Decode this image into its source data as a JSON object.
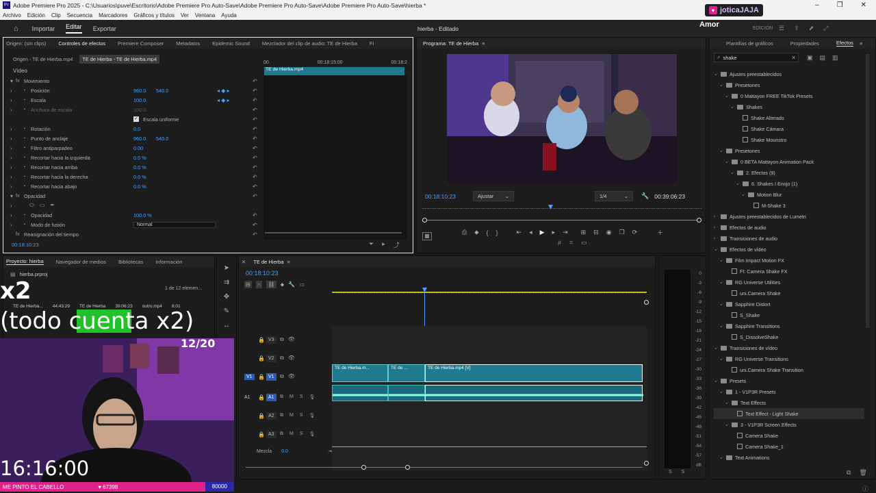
{
  "titlebar": {
    "title": "Adobe Premiere Pro 2025 - C:\\Usuarios\\puve\\Escritorio\\Adobe Premiere Pro Auto-Save\\Adobe Premiere Pro Auto-Save\\Adobe Premiere Pro Auto-Save\\hierba *",
    "app_icon": "Pr"
  },
  "menu": [
    "Archivo",
    "Edición",
    "Clip",
    "Secuencia",
    "Marcadores",
    "Gráficos y títulos",
    "Ver",
    "Ventana",
    "Ayuda"
  ],
  "workspace": {
    "tabs": [
      "Importar",
      "Editar",
      "Exportar"
    ],
    "active": "Editar",
    "project_title": "hierba - Editado",
    "edition_label": "EDICIÓN"
  },
  "stream_overlay": {
    "follower_badge": "joticaJAJA",
    "follower_label": "Amor",
    "counter_big": "x2",
    "counter_text": "(todo cuenta x2)",
    "progress": "12/20",
    "clock": "16:16:00",
    "footer_left": "ME PINTO EL CABELLO",
    "footer_count": "67398",
    "footer_right": "80000"
  },
  "effect_controls": {
    "tabs": [
      "Origen: (sin clips)",
      "Controles de efectos",
      "Premiere Composer",
      "Metadatos",
      "Epidemic Sound",
      "Mezclador del clip de audio: TE de Hierba",
      "Fi"
    ],
    "source_tabs": [
      "Origen - TE de Hierba.mp4",
      "TE de Hierba - TE de Hierba.mp4"
    ],
    "ruler": [
      "00",
      "00:18:15:00",
      "00:18:2"
    ],
    "clip_label": "TE de Hierba.mp4",
    "section_video": "Vídeo",
    "rows": [
      {
        "label": "Movimiento",
        "v1": "",
        "v2": ""
      },
      {
        "label": "Posición",
        "v1": "960.0",
        "v2": "540.0"
      },
      {
        "label": "Escala",
        "v1": "100.0",
        "v2": ""
      },
      {
        "label": "Anchura de escala",
        "v1": "100.0",
        "v2": ""
      },
      {
        "label": "Escala uniforme",
        "v1": "",
        "v2": ""
      },
      {
        "label": "Rotación",
        "v1": "0.0",
        "v2": ""
      },
      {
        "label": "Punto de anclaje",
        "v1": "960.0",
        "v2": "540.0"
      },
      {
        "label": "Filtro antiparpadeo",
        "v1": "0.00",
        "v2": ""
      },
      {
        "label": "Recortar hacia la izquierda",
        "v1": "0.0 %",
        "v2": ""
      },
      {
        "label": "Recortar hacia arriba",
        "v1": "0.0 %",
        "v2": ""
      },
      {
        "label": "Recortar hacia la derecha",
        "v1": "0.0 %",
        "v2": ""
      },
      {
        "label": "Recortar hacia abajo",
        "v1": "0.0 %",
        "v2": ""
      },
      {
        "label": "Opacidad",
        "v1": "",
        "v2": ""
      },
      {
        "label": "",
        "v1": "",
        "v2": ""
      },
      {
        "label": "Opacidad",
        "v1": "100.0 %",
        "v2": ""
      },
      {
        "label": "Modo de fusión",
        "v1": "Normal",
        "v2": ""
      },
      {
        "label": "Reasignación del tiempo",
        "v1": "",
        "v2": ""
      }
    ],
    "timecode": "00:18:10:23"
  },
  "program": {
    "title": "Programa: TE de Hierba",
    "timecode": "00:18:10:23",
    "fit": "Ajustar",
    "resolution": "1/4",
    "duration": "00:39:06:23"
  },
  "project": {
    "tabs": [
      "Proyecto: hierba",
      "Navegador de medios",
      "Bibliotecas",
      "Información"
    ],
    "file": "hierba.prproj",
    "count": "1 de 12 elemen...",
    "items": [
      {
        "name": "TE de Hierba...",
        "dur": "44:43:29"
      },
      {
        "name": "TE de Hierba",
        "dur": "39:06:23"
      },
      {
        "name": "outro.mp4",
        "dur": "8:01"
      }
    ]
  },
  "timeline": {
    "tab": "TE de Hierba",
    "timecode": "00:18:10:23",
    "tracks": [
      {
        "name": "V3"
      },
      {
        "name": "V2"
      },
      {
        "name": "V1"
      },
      {
        "name": "A1"
      },
      {
        "name": "A2"
      },
      {
        "name": "A3"
      }
    ],
    "source_patch": [
      "V1",
      "A1"
    ],
    "mix_label": "Mezcla",
    "mix_value": "0.0",
    "clips": [
      "TE de Hierba.m...",
      "TE de ...",
      "TE de Hierba.mp4 [V]"
    ]
  },
  "meter": {
    "labels": [
      "0",
      "-3",
      "-6",
      "-9",
      "-12",
      "-15",
      "-18",
      "-21",
      "-24",
      "-27",
      "-30",
      "-33",
      "-36",
      "-39",
      "-42",
      "-45",
      "-48",
      "-51",
      "-54",
      "-57",
      "dB"
    ],
    "solo": [
      "S",
      "S"
    ]
  },
  "effects": {
    "tabs": [
      "Plantillas de gráficos",
      "Propiedades",
      "Efectos"
    ],
    "search": "shake",
    "tree": [
      {
        "d": 0,
        "t": "folder",
        "label": "Ajustes preestablecidos"
      },
      {
        "d": 1,
        "t": "folder",
        "label": "Presetones"
      },
      {
        "d": 2,
        "t": "folder",
        "label": "0 Mattayon FREE TikTok Presets"
      },
      {
        "d": 3,
        "t": "folder",
        "label": "Shakes"
      },
      {
        "d": 4,
        "t": "fx",
        "label": "Shake Alterado"
      },
      {
        "d": 4,
        "t": "fx",
        "label": "Shake Cámara"
      },
      {
        "d": 4,
        "t": "fx",
        "label": "Shake Mounstro"
      },
      {
        "d": 1,
        "t": "folder",
        "label": "Presetones"
      },
      {
        "d": 2,
        "t": "folder",
        "label": "0 BETA Mattayon Animation Pack"
      },
      {
        "d": 3,
        "t": "folder",
        "label": "2. Efectos (9)"
      },
      {
        "d": 4,
        "t": "folder",
        "label": "6. Shakes I Enojo (1)"
      },
      {
        "d": 5,
        "t": "folder",
        "label": "Motion Blur"
      },
      {
        "d": 6,
        "t": "fx",
        "label": "M-Shake 3"
      },
      {
        "d": 0,
        "t": "folder",
        "label": "Ajustes preestablecidos de Lumetri"
      },
      {
        "d": 0,
        "t": "folder",
        "label": "Efectos de audio"
      },
      {
        "d": 0,
        "t": "folder",
        "label": "Transiciones de audio"
      },
      {
        "d": 0,
        "t": "folder",
        "label": "Efectos de vídeo"
      },
      {
        "d": 1,
        "t": "folder",
        "label": "Film Impact Motion FX"
      },
      {
        "d": 2,
        "t": "fx",
        "label": "FI: Camera Shake FX"
      },
      {
        "d": 1,
        "t": "folder",
        "label": "RG Universe Utilities"
      },
      {
        "d": 2,
        "t": "fx",
        "label": "uni.Camera Shake"
      },
      {
        "d": 1,
        "t": "folder",
        "label": "Sapphire Distort"
      },
      {
        "d": 2,
        "t": "fx",
        "label": "S_Shake"
      },
      {
        "d": 1,
        "t": "folder",
        "label": "Sapphire Transitions"
      },
      {
        "d": 2,
        "t": "fx",
        "label": "S_DissolveShake"
      },
      {
        "d": 0,
        "t": "folder",
        "label": "Transiciones de vídeo"
      },
      {
        "d": 1,
        "t": "folder",
        "label": "RG Universe Transitions"
      },
      {
        "d": 2,
        "t": "fx",
        "label": "uni.Camera Shake Transition"
      },
      {
        "d": 0,
        "t": "folder",
        "label": "Presets"
      },
      {
        "d": 1,
        "t": "folder",
        "label": "1 - V1P3R Presets"
      },
      {
        "d": 2,
        "t": "folder",
        "label": "Text Effects"
      },
      {
        "d": 3,
        "t": "fx",
        "label": "Text Effect - Light Shake"
      },
      {
        "d": 2,
        "t": "folder",
        "label": "3 - V1P3R Screen Effects"
      },
      {
        "d": 3,
        "t": "fx",
        "label": "Camera Shake"
      },
      {
        "d": 3,
        "t": "fx",
        "label": "Camera Shake_1"
      },
      {
        "d": 1,
        "t": "folder",
        "label": "Text Animations"
      }
    ]
  },
  "colors": {
    "accent": "#4a9eff",
    "clip": "#1f7a8f",
    "badge": "#e0218a",
    "overlay_green": "#22c02a"
  }
}
